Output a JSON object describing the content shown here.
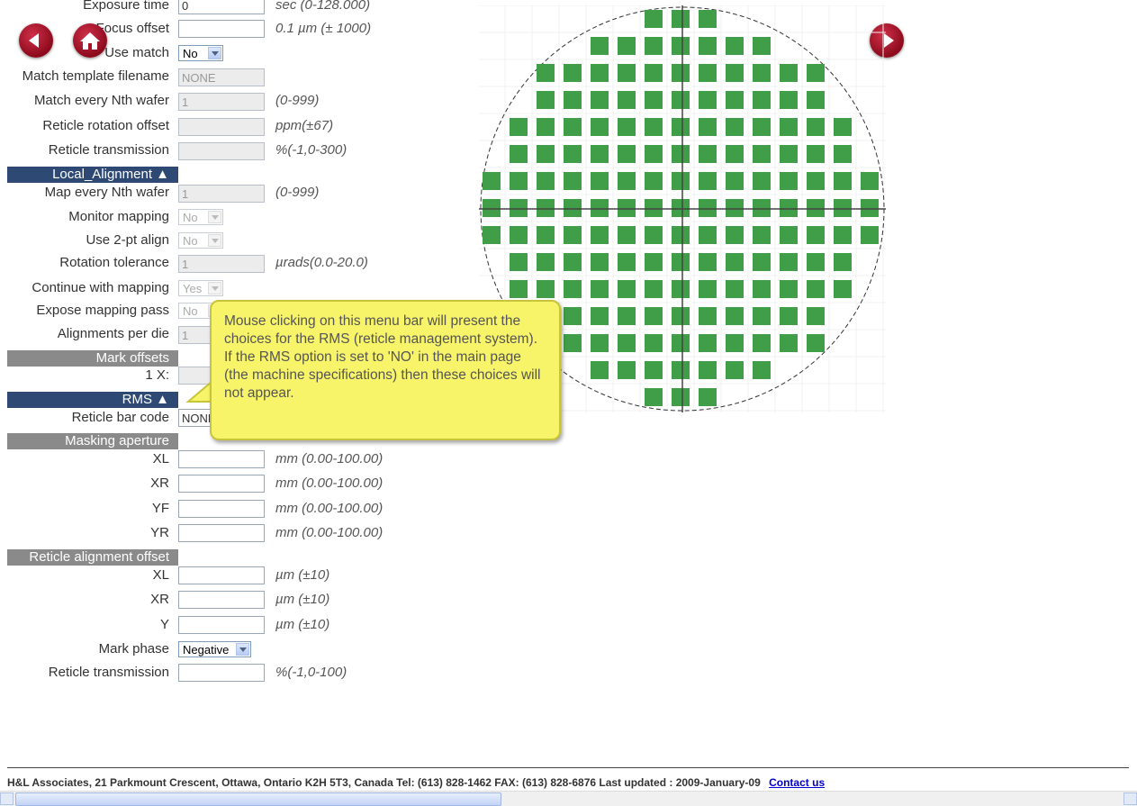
{
  "form": {
    "exposure_time": {
      "label": "Exposure time",
      "value": "0",
      "hint": "sec (0-128.000)"
    },
    "focus_offset": {
      "label": "Focus offset",
      "value": "",
      "hint": "0.1 µm (± 1000)"
    },
    "use_match": {
      "label": "Use match",
      "value": "No"
    },
    "match_template": {
      "label": "Match template filename",
      "value": "NONE"
    },
    "match_every": {
      "label": "Match every Nth wafer",
      "value": "1",
      "hint": "(0-999)"
    },
    "reticle_rotation": {
      "label": "Reticle rotation offset",
      "value": "",
      "hint": "ppm(±67)"
    },
    "reticle_transmission": {
      "label": "Reticle transmission",
      "value": "",
      "hint": "%(-1,0-300)"
    },
    "local_alignment_header": "Local_Alignment ▲",
    "map_every": {
      "label": "Map every Nth wafer",
      "value": "1",
      "hint": "(0-999)"
    },
    "monitor_mapping": {
      "label": "Monitor mapping",
      "value": "No"
    },
    "use_2pt": {
      "label": "Use 2-pt align",
      "value": "No"
    },
    "rotation_tolerance": {
      "label": "Rotation tolerance",
      "value": "1",
      "hint": "µrads(0.0-20.0)"
    },
    "continue_mapping": {
      "label": "Continue with mapping",
      "value": "Yes"
    },
    "expose_mapping": {
      "label": "Expose mapping pass",
      "value": "No"
    },
    "alignments_per_die": {
      "label": "Alignments per die",
      "value": "1"
    },
    "mark_offsets_header": "Mark offsets",
    "mark_1x": {
      "label": "1 X:",
      "value": ""
    },
    "rms_header": "RMS ▲",
    "reticle_bar_code": {
      "label": "Reticle bar code",
      "value": "NONE"
    },
    "masking_header": "Masking aperture",
    "mask_xl": {
      "label": "XL",
      "value": "",
      "hint": "mm (0.00-100.00)"
    },
    "mask_xr": {
      "label": "XR",
      "value": "",
      "hint": "mm (0.00-100.00)"
    },
    "mask_yf": {
      "label": "YF",
      "value": "",
      "hint": "mm (0.00-100.00)"
    },
    "mask_yr": {
      "label": "YR",
      "value": "",
      "hint": "mm (0.00-100.00)"
    },
    "reticle_align_header": "Reticle alignment offset",
    "ra_xl": {
      "label": "XL",
      "value": "",
      "hint": "µm (±10)"
    },
    "ra_xr": {
      "label": "XR",
      "value": "",
      "hint": "µm (±10)"
    },
    "ra_y": {
      "label": "Y",
      "value": "",
      "hint": "µm (±10)"
    },
    "mark_phase": {
      "label": "Mark phase",
      "value": "Negative"
    },
    "reticle_transmission2": {
      "label": "Reticle transmission",
      "value": "",
      "hint": "%(-1,0-100)"
    }
  },
  "callout": {
    "text": "Mouse clicking on this menu bar will present the choices for the RMS (reticle management system). If the RMS option is set to 'NO' in the main page (the machine specifications) then these choices will not appear."
  },
  "wafer_map": {
    "die_color": "#3f9e47",
    "rows": [
      [
        6,
        8
      ],
      [
        4,
        10
      ],
      [
        2,
        12
      ],
      [
        2,
        12
      ],
      [
        1,
        13
      ],
      [
        1,
        13
      ],
      [
        0,
        14
      ],
      [
        0,
        14
      ],
      [
        0,
        14
      ],
      [
        1,
        13
      ],
      [
        1,
        13
      ],
      [
        2,
        12
      ],
      [
        2,
        12
      ],
      [
        4,
        10
      ],
      [
        6,
        8
      ]
    ]
  },
  "nav": {
    "back_icon": "left-arrow-icon",
    "home_icon": "home-icon",
    "forward_icon": "right-arrow-icon"
  },
  "footer": {
    "text": "H&L Associates, 21 Parkmount Crescent, Ottawa, Ontario K2H 5T3, Canada  Tel: (613) 828-1462   FAX: (613) 828-6876    Last updated : 2009-January-09",
    "contact": "Contact us"
  }
}
